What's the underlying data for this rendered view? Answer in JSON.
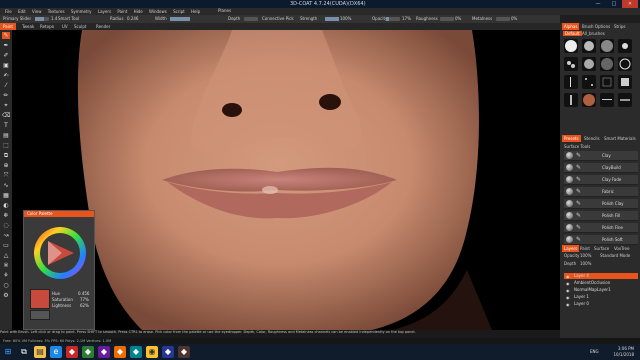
{
  "window": {
    "title": "3D-COAT 4.7.24(CUDA)(DX64)",
    "min": "—",
    "max": "□",
    "close": "✕"
  },
  "menu": [
    "File",
    "Edit",
    "View",
    "Textures",
    "Symmetry",
    "Layers",
    "Paint",
    "Hide",
    "Windows",
    "Script",
    "Help"
  ],
  "toolbar": {
    "pressure_label": "Primary Slider",
    "pressure_val": "1.4",
    "smooth_label": "Smart Tool",
    "radius_label": "Radius",
    "radius_val": "0.246",
    "width_label": "Width",
    "width_val": "100%",
    "depth_label": "Depth",
    "depth_val": "0%",
    "connective_label": "Connective Pick",
    "strength_label": "Strength",
    "strength_val": "100%",
    "opacity_label": "Opacity",
    "opacity_val": "17%",
    "roughness_label": "Roughness",
    "roughness_val": "0%",
    "metalness_label": "Metalness",
    "metalness_val": "0%",
    "planes_label": "Planes"
  },
  "room_tabs": [
    "Paint",
    "Tweak",
    "Retopo",
    "UV",
    "Sculpt",
    "Render"
  ],
  "color_panel": {
    "title": "Color Palette",
    "hue_label": "Hue",
    "hue_val": "0.456",
    "sat_label": "Saturation",
    "sat_val": "77%",
    "light_label": "Lightness",
    "light_val": "62%",
    "current_color": "#c84a3c"
  },
  "right_panel": {
    "top_tabs": [
      "Alphas",
      "Brush Options",
      "Strips"
    ],
    "alpha_folder": "Default",
    "alpha_sub": "All_brushes",
    "mid_tabs": [
      "Presets",
      "Stencils",
      "Smart Materials"
    ],
    "preset_folder": "Surface Tools",
    "presets": [
      "Clay",
      "ClayBuild",
      "Clay Fade",
      "Fabric",
      "Polish Clay",
      "Polish Fill",
      "Polish Fine",
      "Polish Soft"
    ],
    "layer_tabs": [
      "Layers",
      "Paint",
      "Surface",
      "VoxTree"
    ],
    "blend_label": "Standard Mode",
    "opacity_label": "Opacity",
    "opacity_val": "100%",
    "depth_label": "Depth",
    "depth_val": "100%",
    "layers": [
      "Layer 4",
      "AmbientOcclusion",
      "NormalMapLayer1",
      "Layer 1",
      "Layer 0"
    ]
  },
  "status": {
    "hint": "Paint with Brush. Left click or drag to paint. Press SHIFT to smooth. Press CTRL to erase. Pick color from the palette or use the eyedropper. Depth, Color, Roughness and Metalness channels can be enabled independently on the top panel.",
    "info": "Free: 60% VM Fullness: 3%  FPS: 60  Polys: 2.1M  Vertices: 1.0M"
  },
  "taskbar": {
    "time": "3:06 PM",
    "date": "10/1/2018",
    "lang": "ENG"
  },
  "colors": {
    "accent": "#e8541c",
    "skin_base": "#c78a6e",
    "lip": "#b86a5e"
  }
}
